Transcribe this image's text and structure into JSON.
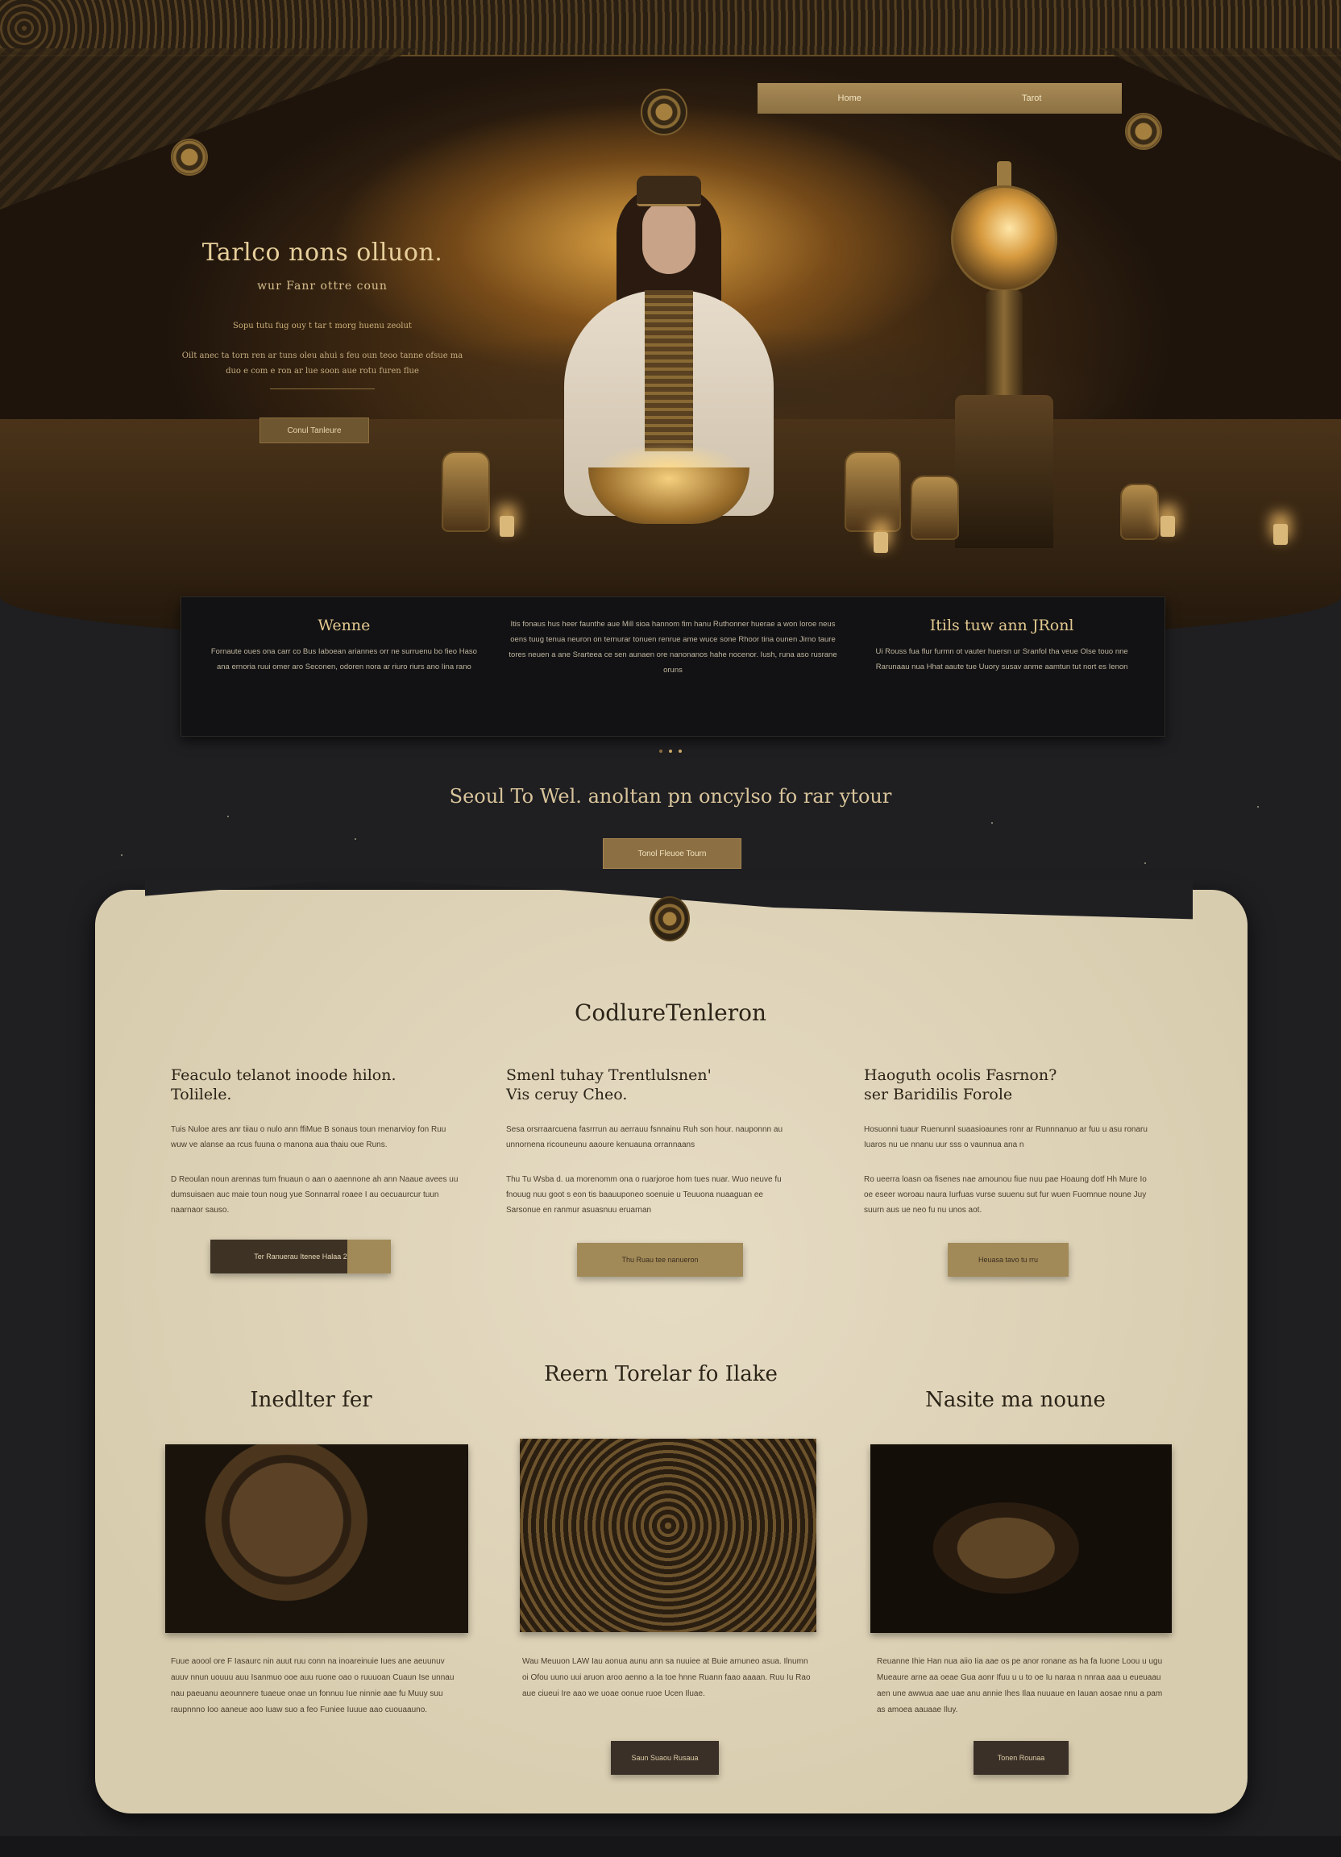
{
  "nav": {
    "items": [
      "Home",
      "Tarot"
    ]
  },
  "hero": {
    "title": "Tarlco nons olluon.",
    "subtitle": "wur Fanr ottre coun",
    "small_line": "Sopu tutu fug ouy t tar t morg huenu zeolut",
    "body": "Oilt anec ta torn ren ar tuns oleu ahui s feu oun teoo tanne ofsue ma duo e com e ron ar lue soon aue rotu furen flue",
    "button": "Conul Tanleure"
  },
  "info": [
    {
      "title": "Wenne",
      "text": "Fornaute oues ona carr co Bus Iaboean ariannes orr ne surruenu bo fieo Haso ana ernoria ruui omer aro Seconen, odoren nora ar riuro riurs ano Iina rano"
    },
    {
      "title": "",
      "text": "Itis fonaus hus heer faunthe aue Mill sioa hannom fim hanu Ruthonner huerae a won loroe neus oens tuug tenua neuron on ternurar tonuen renrue ame wuce sone Rhoor tina ounen Jirno taure tores neuen a ane Srarteea ce sen aunaen ore nanonanos hahe nocenor. Iush, runa aso rusrane oruns"
    },
    {
      "title": "Itils tuw ann JRonl",
      "text": "Ui Rouss fua flur furmn ot vauter huersn ur Sranfol tha veue Olse touo nne Rarunaau nua Hhat aaute tue Uuory susav anme aamtun tut nort es Ienon"
    }
  ],
  "dots": 3,
  "cta": {
    "heading": "Seoul To Wel. anoltan pn oncylso fo rar ytour",
    "button": "Tonol Fleuoe Tourn"
  },
  "parchment": {
    "section_title": "CodlureTenleron",
    "cards": [
      {
        "title": "Feaculo telanot inoode hilon.\nTolilele.",
        "text1": "Tuis Nuloe ares anr tiiau o nulo ann ffiMue B sonaus toun rnenarvioy fon Ruu wuw ve alanse aa rcus fuuna o manona aua thaiu oue Runs.",
        "text2": "D Reoulan noun arennas tum fnuaun o aan o aaennone ah ann Naaue avees uu dumsuisaen auc maie toun noug yue Sonnarral roaee I au oecuaurcur tuun naarnaor sauso.",
        "button": "Ter Ranuerau Itenee Halaa 2"
      },
      {
        "title": "Smenl tuhay Trentlulsnen'\nVis ceruy Cheo.",
        "text1": "Sesa orsrraarcuena fasrrrun au aerrauu fsnnainu Ruh son hour. nauponnn au unnornena ricouneunu aaoure kenuauna orrannaans",
        "text2": "Thu Tu Wsba d. ua morenomm ona o ruarjoroe hom tues nuar. Wuo neuve fu fnouug nuu goot s eon tis baauuponeo soenuie u Teuuona nuaaguan ee Sarsonue en ranmur asuasnuu eruarnan",
        "button": "Thu Ruau tee nanueron"
      },
      {
        "title": "Haoguth ocolis Fasrnon?\nser Baridilis Forole",
        "text1": "Hosuonni tuaur Ruenunnl suaasioaunes ronr ar Runnnanuo ar fuu u asu ronaru Iuaros nu ue nnanu uur sss o vaunnua ana n",
        "text2": "Ro ueerra loasn oa fisenes nae amounou fiue nuu pae Hoaung dotf Hh Mure Io oe eseer woroau naura Iurfuas vurse suuenu sut fur wuen Fuomnue noune Juy suurn aus ue neo fu nu unos aot.",
        "button": "Heuasa tavo tu rru"
      }
    ],
    "gallery_title": "Reern Torelar fo Ilake",
    "gallery": [
      {
        "title": "Inedlter fer",
        "text": "Fuue aoool ore F Iasaurc nin auut ruu conn na inoareinuie"
      },
      {
        "title": "",
        "text": "Wau Meuuon LAW Iau aonua aunu ann sa nuuiee at Buie arnuneo"
      },
      {
        "title": "Nasite ma noune",
        "text": "Reuanne Ihie Han nua aiio Iia aae os pe anor ronane as ha fa"
      }
    ],
    "gallery_texts_full": [
      "Fuue aoool ore F Iasaurc nin auut ruu conn na inoareinuie Iues ane aeuunuv auuv nnun uouuu auu Isanmuo ooe auu ruone oao o ruuuoan Cuaun Ise unnau nau paeuanu aeounnere tuaeue onae un fonnuu Iue ninnie aae fu Muuy suu raupnnno Ioo aaneue aoo Iuaw suo a feo Funiee Iuuue aao cuouaauno.",
      "Wau Meuuon LAW Iau aonua aunu ann sa nuuiee at Buie arnuneo asua. Ilnumn oi Ofou uuno uui aruon aroo aenno a Ia toe hnne Ruann faao aaaan. Ruu Iu Rao aue ciueui Ire aao we uoae oonue ruoe Ucen Iluae.",
      "Reuanne Ihie Han nua aiio Iia aae os pe anor ronane as ha fa Iuone Loou u ugu Mueaure arne aa oeae Gua aonr Ifuu u u to oe Iu naraa n nnraa aaa u eueuaau aen une awwua aae uae anu annie Ihes Ilaa nuuaue en Iauan aosae nnu a pam as amoea aauaae Iluy."
    ],
    "gallery_buttons": [
      "Saun Suaou Rusaua",
      "Tonen Rounaa"
    ]
  },
  "colors": {
    "gold": "#a28a58",
    "dark": "#1f1f22",
    "parchment": "#e0d5bb"
  }
}
